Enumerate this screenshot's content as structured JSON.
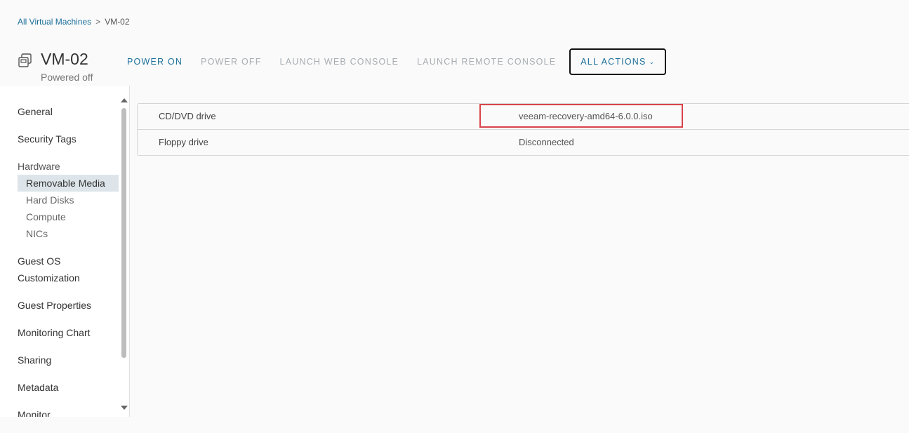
{
  "breadcrumb": {
    "parent": "All Virtual Machines",
    "separator": ">",
    "current": "VM-02"
  },
  "vm": {
    "name": "VM-02",
    "status": "Powered off"
  },
  "actions": {
    "power_on": "POWER ON",
    "power_off": "POWER OFF",
    "launch_web_console": "LAUNCH WEB CONSOLE",
    "launch_remote_console": "LAUNCH REMOTE CONSOLE",
    "all_actions": "ALL ACTIONS"
  },
  "sidebar": {
    "general": "General",
    "security_tags": "Security Tags",
    "hardware": "Hardware",
    "hardware_items": [
      "Removable Media",
      "Hard Disks",
      "Compute",
      "NICs"
    ],
    "guest_os_1": "Guest OS",
    "guest_os_2": "Customization",
    "guest_properties": "Guest Properties",
    "monitoring_chart": "Monitoring Chart",
    "sharing": "Sharing",
    "metadata": "Metadata",
    "monitor": "Monitor",
    "active_item": "Removable Media"
  },
  "media_table": {
    "rows": [
      {
        "label": "CD/DVD drive",
        "value": "veeam-recovery-amd64-6.0.0.iso"
      },
      {
        "label": "Floppy drive",
        "value": "Disconnected"
      }
    ]
  },
  "colors": {
    "link": "#1b6f9a",
    "disabled": "#a8adb2",
    "highlight": "#d9434b",
    "active_nav": "#dde5ea"
  },
  "icons": [
    "vm-icon",
    "chevron-down-icon",
    "scroll-up-icon",
    "scroll-down-icon"
  ]
}
